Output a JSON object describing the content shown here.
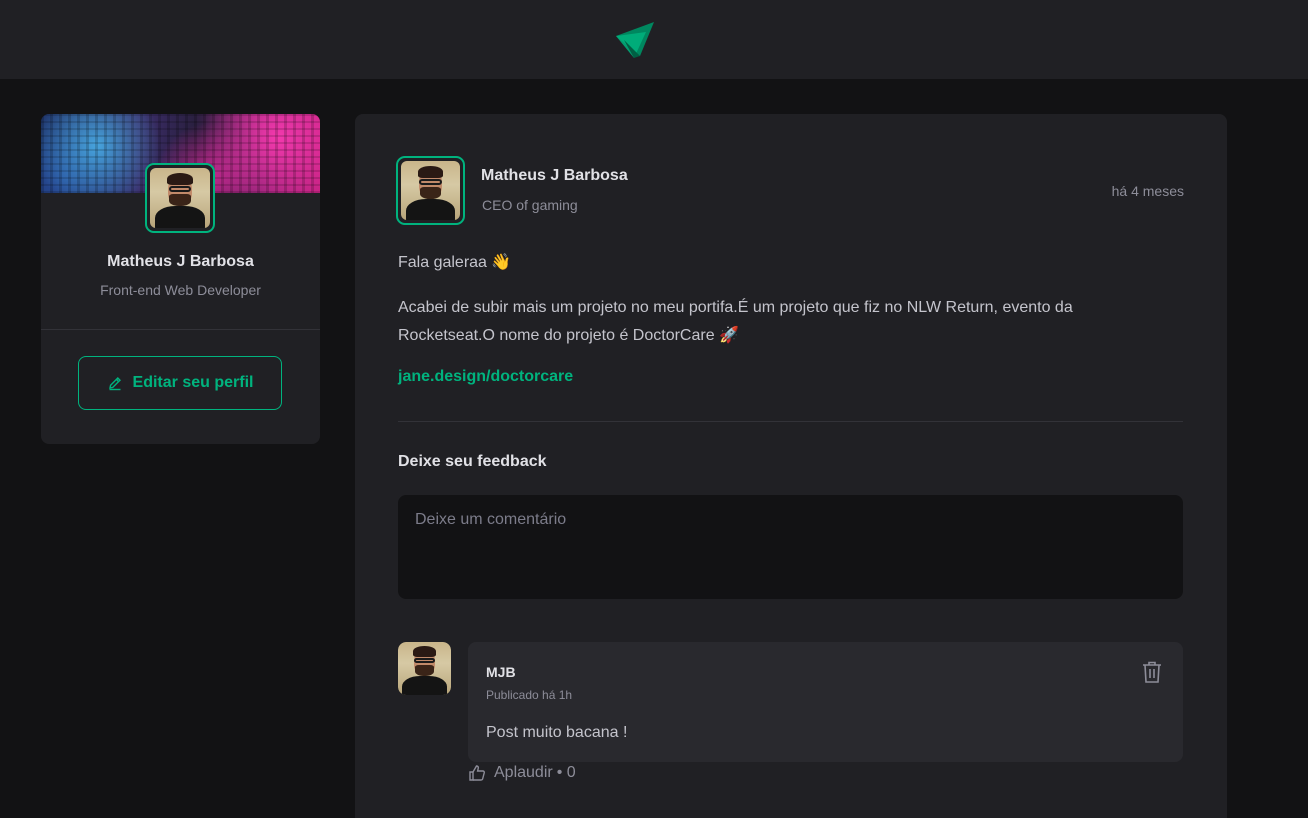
{
  "header": {
    "logo_icon": "ignite-triangle-logo-icon"
  },
  "sidebar": {
    "name": "Matheus J Barbosa",
    "role": "Front-end Web Developer",
    "edit_button": {
      "label": "Editar seu perfil",
      "icon": "pencil-icon"
    }
  },
  "post": {
    "author": {
      "name": "Matheus J Barbosa",
      "role": "CEO of gaming"
    },
    "time": "há 4 meses",
    "paragraphs": [
      "Fala galeraa 👋",
      "Acabei de subir mais um projeto no meu portifa.É um projeto que fiz no NLW Return, evento da Rocketseat.O nome do projeto é DoctorCare 🚀"
    ],
    "link": "jane.design/doctorcare",
    "feedback": {
      "title": "Deixe seu feedback",
      "placeholder": "Deixe um comentário"
    },
    "comment": {
      "author": "MJB",
      "time": "Publicado há 1h",
      "text": "Post muito bacana !",
      "applaud_label": "Aplaudir",
      "applaud_count": "• 0"
    }
  },
  "colors": {
    "accent": "#00b37e",
    "background": "#121214",
    "surface": "#202024",
    "comment_surface": "#29292e"
  }
}
